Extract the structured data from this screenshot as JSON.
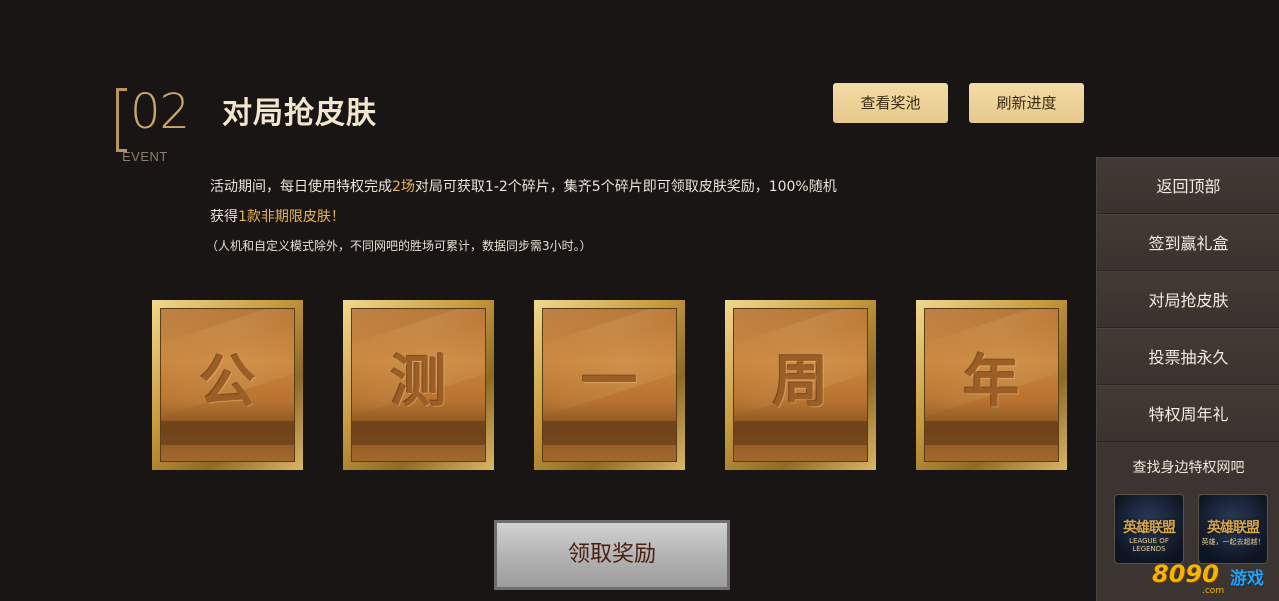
{
  "event": {
    "number": "02",
    "word": "EVENT",
    "title": "对局抢皮肤"
  },
  "buttons": {
    "view_pool": "查看奖池",
    "refresh": "刷新进度",
    "claim": "领取奖励"
  },
  "description": {
    "line1_a": "活动期间，每日使用特权完成",
    "line1_hl": "2场",
    "line1_b": "对局可获取1-2个碎片，集齐5个碎片即可领取皮肤奖励，100%随机",
    "line2_a": "获得",
    "line2_hl": "1款非期限皮肤！",
    "note": "（人机和自定义模式除外，不同网吧的胜场可累计，数据同步需3小时。）"
  },
  "cards": [
    "公",
    "测",
    "一",
    "周",
    "年"
  ],
  "side_nav": {
    "items": [
      "返回顶部",
      "签到赢礼盒",
      "对局抢皮肤",
      "投票抽永久",
      "特权周年礼"
    ],
    "find_label": "查找身边特权网吧",
    "thumbs": [
      {
        "logo": "英雄联盟",
        "sub": "LEAGUE OF LEGENDS"
      },
      {
        "logo": "英雄联盟",
        "sub": "英雄，一起去超越！"
      }
    ]
  },
  "watermark": {
    "number": "8090",
    "game": "游戏",
    "com": ".com"
  },
  "colors": {
    "background": "#181514",
    "accent_gold": "#e6c98c",
    "highlight": "#e6b45a",
    "sidebar": "#3c3430"
  }
}
